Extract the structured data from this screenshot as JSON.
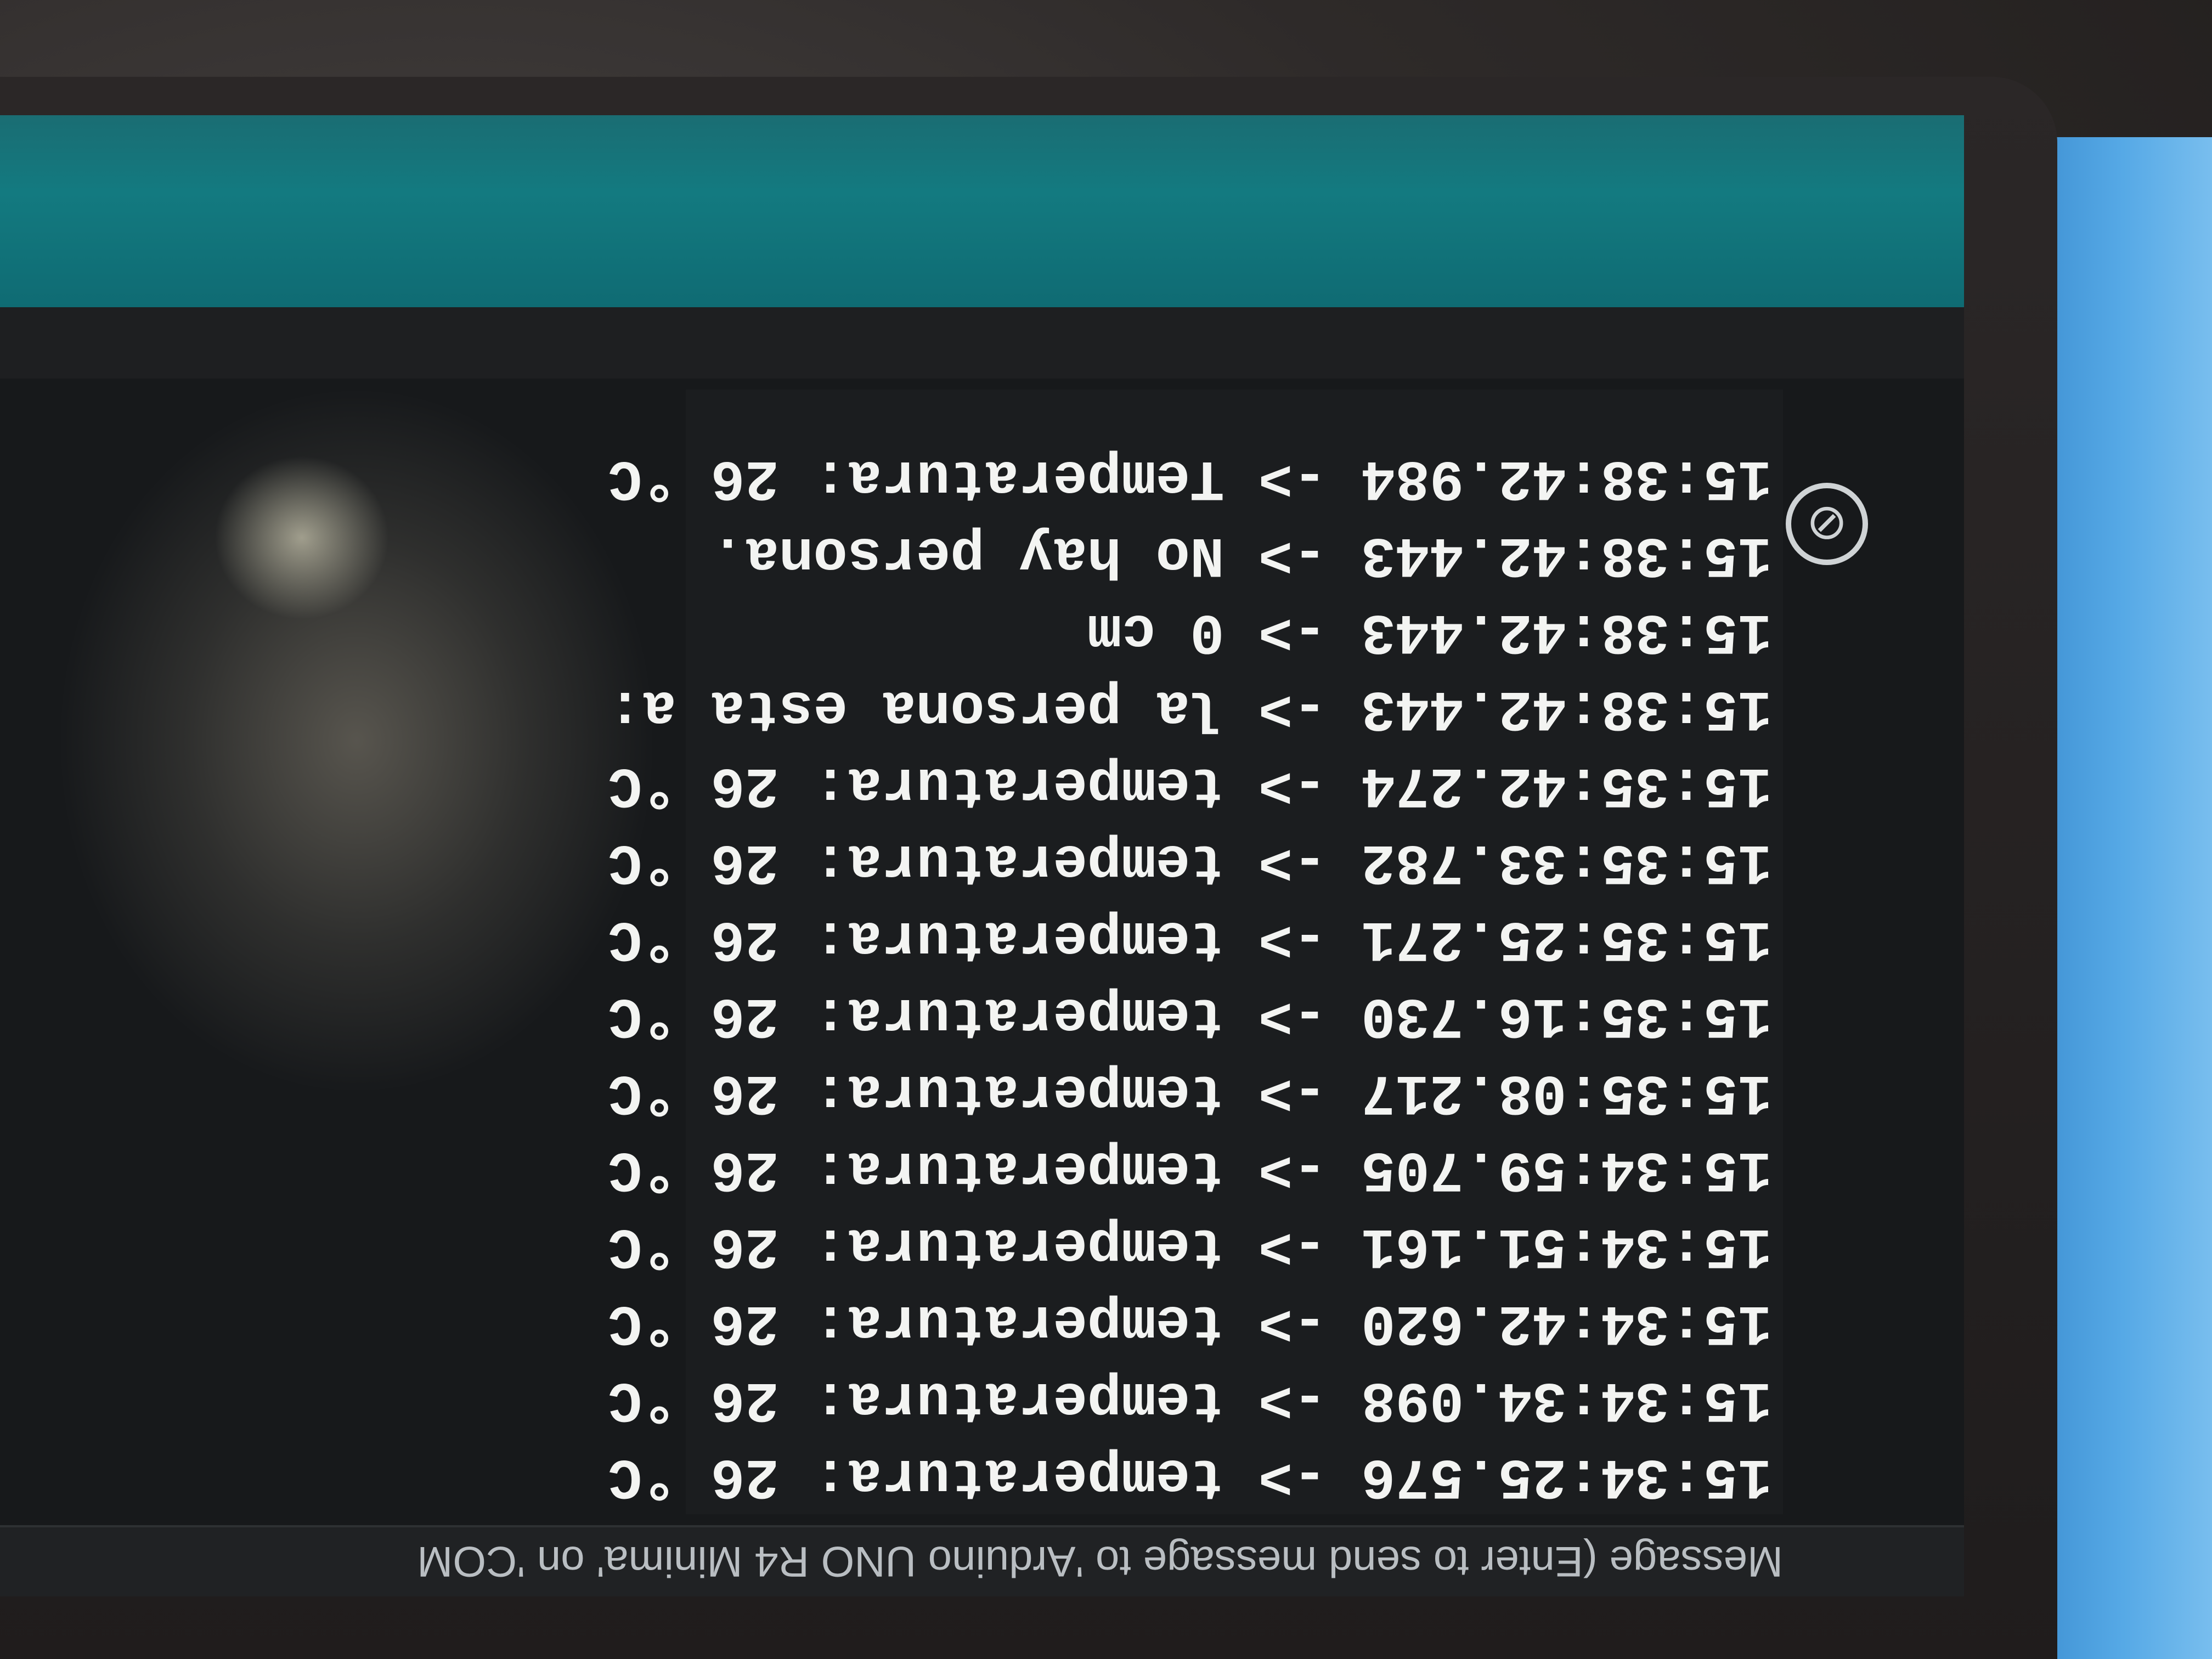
{
  "serial_monitor": {
    "message_input": {
      "placeholder": "Message (Enter to send message to 'Arduino UNO R4 Minima' on 'COM"
    },
    "clear_icon_glyph": "⊘",
    "lines": [
      "15:38:42.984 -> Temperatura: 26 °C",
      "15:38:42.443 -> No hay persona.",
      "15:38:42.443 -> 0 cm",
      "15:38:42.443 -> la persona esta a:",
      "15:35:42.274 -> temperatura: 26 °C",
      "15:35:33.782 -> temperatura: 26 °C",
      "15:35:25.271 -> temperatura: 26 °C",
      "15:35:16.730 -> temperatura: 26 °C",
      "15:35:08.217 -> temperatura: 26 °C",
      "15:34:59.705 -> temperatura: 26 °C",
      "15:34:51.161 -> temperatura: 26 °C",
      "15:34:42.620 -> temperatura: 26 °C",
      "15:34:34.098 -> temperatura: 26 °C",
      "15:34:25.576 -> temperatura: 26 °C"
    ]
  },
  "colors": {
    "header_teal": "#137a80",
    "output_background": "#1b1d1f",
    "output_text": "#f3f4f2"
  }
}
